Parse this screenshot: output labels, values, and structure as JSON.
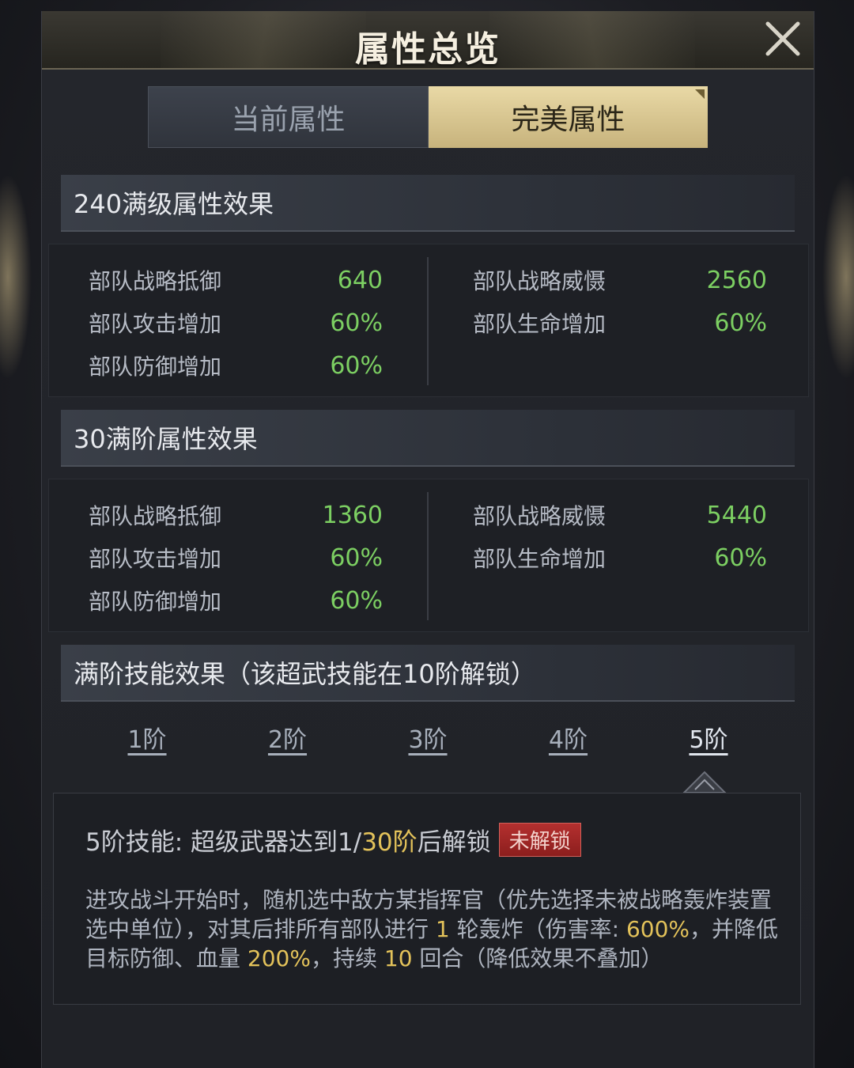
{
  "window": {
    "title": "属性总览"
  },
  "tabs": [
    {
      "label": "当前属性",
      "active": false
    },
    {
      "label": "完美属性",
      "active": true
    }
  ],
  "sections": [
    {
      "title": "240满级属性效果",
      "left": [
        {
          "label": "部队战略抵御",
          "value": "640"
        },
        {
          "label": "部队攻击增加",
          "value": "60%"
        },
        {
          "label": "部队防御增加",
          "value": "60%"
        }
      ],
      "right": [
        {
          "label": "部队战略威慑",
          "value": "2560"
        },
        {
          "label": "部队生命增加",
          "value": "60%"
        }
      ]
    },
    {
      "title": "30满阶属性效果",
      "left": [
        {
          "label": "部队战略抵御",
          "value": "1360"
        },
        {
          "label": "部队攻击增加",
          "value": "60%"
        },
        {
          "label": "部队防御增加",
          "value": "60%"
        }
      ],
      "right": [
        {
          "label": "部队战略威慑",
          "value": "5440"
        },
        {
          "label": "部队生命增加",
          "value": "60%"
        }
      ]
    }
  ],
  "skill": {
    "title": "满阶技能效果（该超武技能在10阶解锁）",
    "tiers": [
      "1阶",
      "2阶",
      "3阶",
      "4阶",
      "5阶"
    ],
    "selected_tier": "5阶",
    "head_prefix": "5阶技能: 超级武器达到1/",
    "head_gold": "30阶",
    "head_suffix": "后解锁",
    "lock_badge": "未解锁",
    "desc_parts": [
      "进攻战斗开始时，随机选中敌方某指挥官（优先选择未被战略轰炸装置选中单位），对其后排所有部队进行 ",
      "1",
      " 轮轰炸（伤害率: ",
      "600%",
      "，并降低目标防御、血量 ",
      "200%",
      "，持续 ",
      "10",
      " 回合（降低效果不叠加）"
    ]
  },
  "colors": {
    "value_green": "#7ccf62",
    "highlight_gold": "#e3c25a",
    "tab_active": "#e9d9a6",
    "badge_red": "#b4302f"
  },
  "icons": {
    "close": "close-icon",
    "pointer": "triangle-pointer-icon"
  }
}
